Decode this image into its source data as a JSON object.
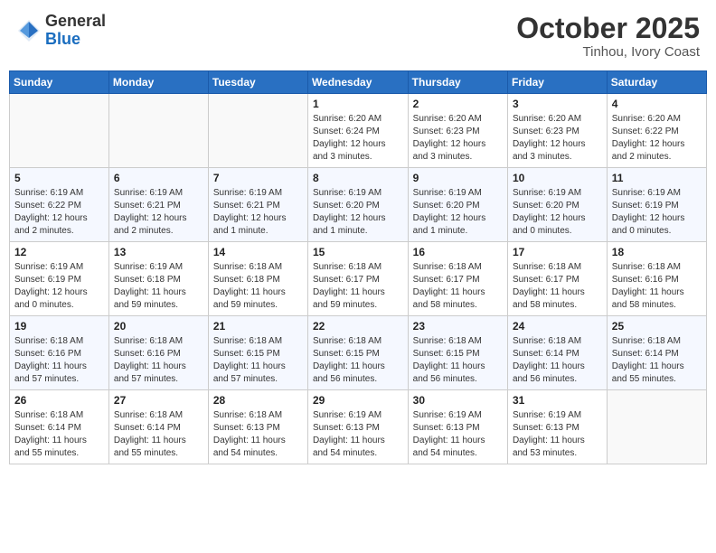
{
  "header": {
    "logo_general": "General",
    "logo_blue": "Blue",
    "month": "October 2025",
    "location": "Tinhou, Ivory Coast"
  },
  "days_of_week": [
    "Sunday",
    "Monday",
    "Tuesday",
    "Wednesday",
    "Thursday",
    "Friday",
    "Saturday"
  ],
  "weeks": [
    [
      {
        "day": "",
        "info": ""
      },
      {
        "day": "",
        "info": ""
      },
      {
        "day": "",
        "info": ""
      },
      {
        "day": "1",
        "info": "Sunrise: 6:20 AM\nSunset: 6:24 PM\nDaylight: 12 hours\nand 3 minutes."
      },
      {
        "day": "2",
        "info": "Sunrise: 6:20 AM\nSunset: 6:23 PM\nDaylight: 12 hours\nand 3 minutes."
      },
      {
        "day": "3",
        "info": "Sunrise: 6:20 AM\nSunset: 6:23 PM\nDaylight: 12 hours\nand 3 minutes."
      },
      {
        "day": "4",
        "info": "Sunrise: 6:20 AM\nSunset: 6:22 PM\nDaylight: 12 hours\nand 2 minutes."
      }
    ],
    [
      {
        "day": "5",
        "info": "Sunrise: 6:19 AM\nSunset: 6:22 PM\nDaylight: 12 hours\nand 2 minutes."
      },
      {
        "day": "6",
        "info": "Sunrise: 6:19 AM\nSunset: 6:21 PM\nDaylight: 12 hours\nand 2 minutes."
      },
      {
        "day": "7",
        "info": "Sunrise: 6:19 AM\nSunset: 6:21 PM\nDaylight: 12 hours\nand 1 minute."
      },
      {
        "day": "8",
        "info": "Sunrise: 6:19 AM\nSunset: 6:20 PM\nDaylight: 12 hours\nand 1 minute."
      },
      {
        "day": "9",
        "info": "Sunrise: 6:19 AM\nSunset: 6:20 PM\nDaylight: 12 hours\nand 1 minute."
      },
      {
        "day": "10",
        "info": "Sunrise: 6:19 AM\nSunset: 6:20 PM\nDaylight: 12 hours\nand 0 minutes."
      },
      {
        "day": "11",
        "info": "Sunrise: 6:19 AM\nSunset: 6:19 PM\nDaylight: 12 hours\nand 0 minutes."
      }
    ],
    [
      {
        "day": "12",
        "info": "Sunrise: 6:19 AM\nSunset: 6:19 PM\nDaylight: 12 hours\nand 0 minutes."
      },
      {
        "day": "13",
        "info": "Sunrise: 6:19 AM\nSunset: 6:18 PM\nDaylight: 11 hours\nand 59 minutes."
      },
      {
        "day": "14",
        "info": "Sunrise: 6:18 AM\nSunset: 6:18 PM\nDaylight: 11 hours\nand 59 minutes."
      },
      {
        "day": "15",
        "info": "Sunrise: 6:18 AM\nSunset: 6:17 PM\nDaylight: 11 hours\nand 59 minutes."
      },
      {
        "day": "16",
        "info": "Sunrise: 6:18 AM\nSunset: 6:17 PM\nDaylight: 11 hours\nand 58 minutes."
      },
      {
        "day": "17",
        "info": "Sunrise: 6:18 AM\nSunset: 6:17 PM\nDaylight: 11 hours\nand 58 minutes."
      },
      {
        "day": "18",
        "info": "Sunrise: 6:18 AM\nSunset: 6:16 PM\nDaylight: 11 hours\nand 58 minutes."
      }
    ],
    [
      {
        "day": "19",
        "info": "Sunrise: 6:18 AM\nSunset: 6:16 PM\nDaylight: 11 hours\nand 57 minutes."
      },
      {
        "day": "20",
        "info": "Sunrise: 6:18 AM\nSunset: 6:16 PM\nDaylight: 11 hours\nand 57 minutes."
      },
      {
        "day": "21",
        "info": "Sunrise: 6:18 AM\nSunset: 6:15 PM\nDaylight: 11 hours\nand 57 minutes."
      },
      {
        "day": "22",
        "info": "Sunrise: 6:18 AM\nSunset: 6:15 PM\nDaylight: 11 hours\nand 56 minutes."
      },
      {
        "day": "23",
        "info": "Sunrise: 6:18 AM\nSunset: 6:15 PM\nDaylight: 11 hours\nand 56 minutes."
      },
      {
        "day": "24",
        "info": "Sunrise: 6:18 AM\nSunset: 6:14 PM\nDaylight: 11 hours\nand 56 minutes."
      },
      {
        "day": "25",
        "info": "Sunrise: 6:18 AM\nSunset: 6:14 PM\nDaylight: 11 hours\nand 55 minutes."
      }
    ],
    [
      {
        "day": "26",
        "info": "Sunrise: 6:18 AM\nSunset: 6:14 PM\nDaylight: 11 hours\nand 55 minutes."
      },
      {
        "day": "27",
        "info": "Sunrise: 6:18 AM\nSunset: 6:14 PM\nDaylight: 11 hours\nand 55 minutes."
      },
      {
        "day": "28",
        "info": "Sunrise: 6:18 AM\nSunset: 6:13 PM\nDaylight: 11 hours\nand 54 minutes."
      },
      {
        "day": "29",
        "info": "Sunrise: 6:19 AM\nSunset: 6:13 PM\nDaylight: 11 hours\nand 54 minutes."
      },
      {
        "day": "30",
        "info": "Sunrise: 6:19 AM\nSunset: 6:13 PM\nDaylight: 11 hours\nand 54 minutes."
      },
      {
        "day": "31",
        "info": "Sunrise: 6:19 AM\nSunset: 6:13 PM\nDaylight: 11 hours\nand 53 minutes."
      },
      {
        "day": "",
        "info": ""
      }
    ]
  ]
}
